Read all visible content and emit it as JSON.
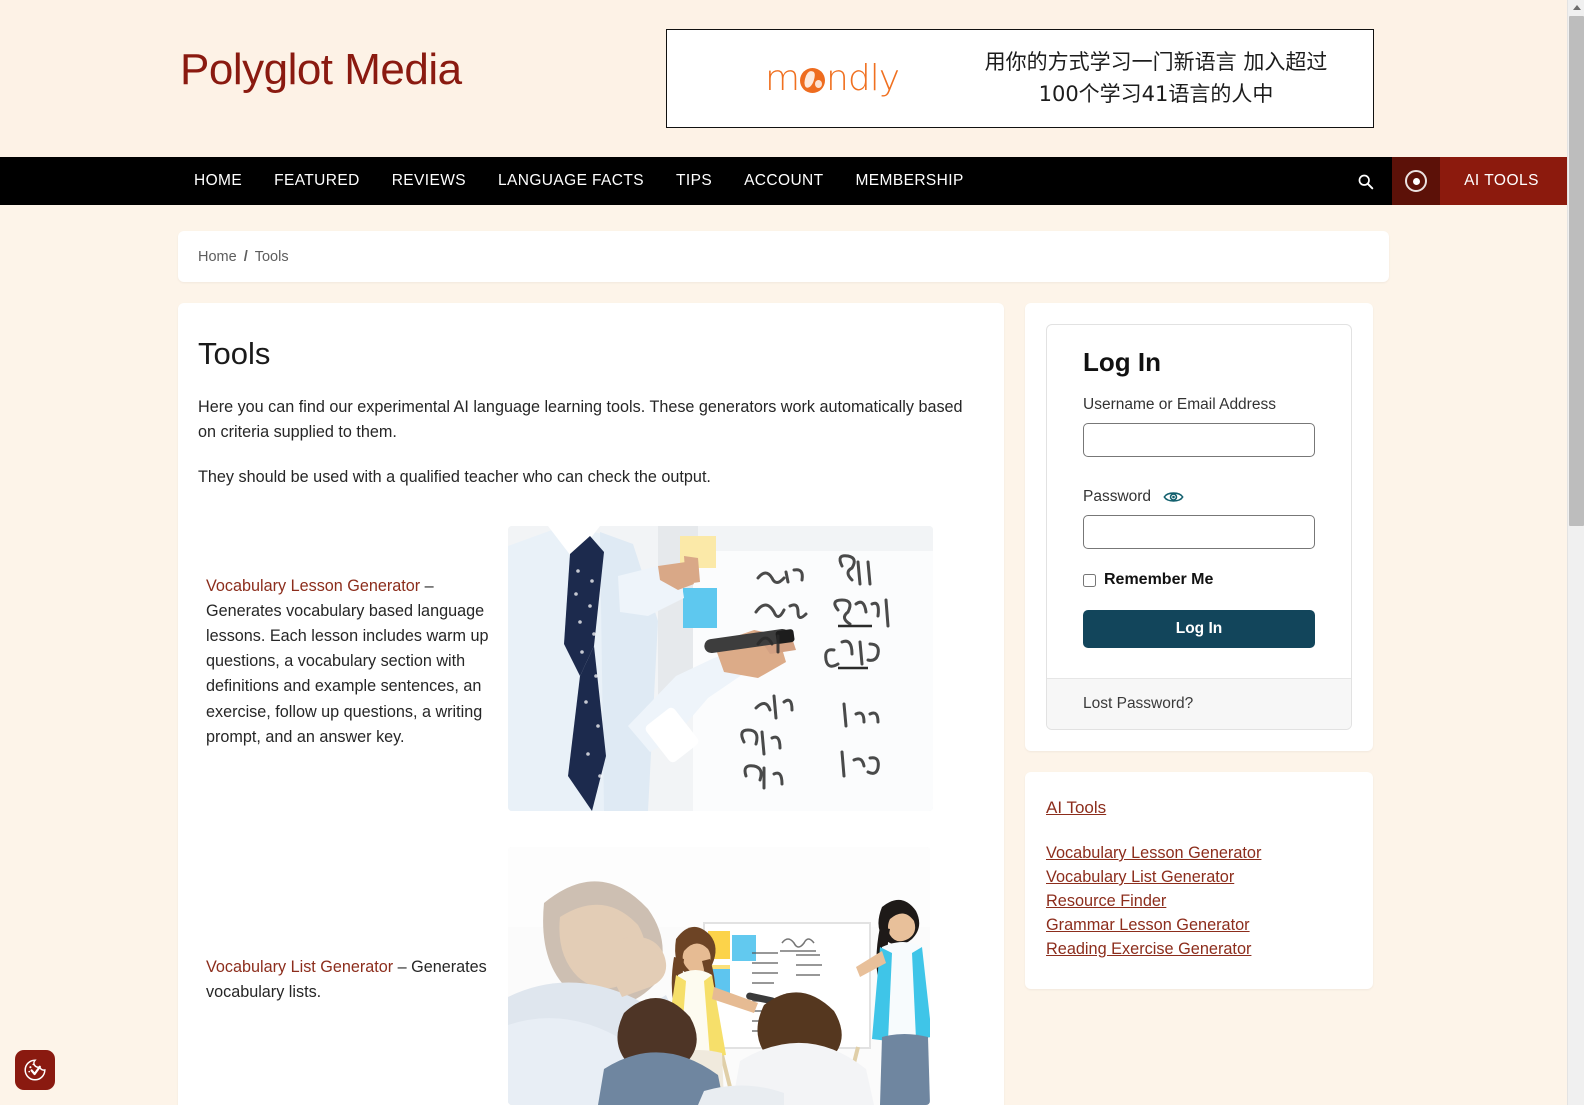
{
  "site": {
    "logo_text": "Polyglot Media"
  },
  "ad": {
    "brand": "mondly",
    "brand_pre": "m",
    "brand_post": "ndly",
    "copy_line1": "用你的方式学习一门新语言 加入超过",
    "copy_line2": "100个学习41语言的人中"
  },
  "nav": {
    "items": [
      {
        "label": "HOME"
      },
      {
        "label": "FEATURED"
      },
      {
        "label": "REVIEWS"
      },
      {
        "label": "LANGUAGE FACTS"
      },
      {
        "label": "TIPS"
      },
      {
        "label": "ACCOUNT"
      },
      {
        "label": "MEMBERSHIP"
      }
    ],
    "search_icon": "search-icon",
    "ai_icon": "record-dot-icon",
    "ai_button_label": "AI TOOLS"
  },
  "breadcrumb": {
    "home": "Home",
    "separator": "/",
    "current": "Tools"
  },
  "main": {
    "title": "Tools",
    "paragraph1": "Here you can find our experimental AI language learning tools. These generators work automatically based on criteria supplied to them.",
    "paragraph2": "They should be used with a qualified teacher who can check the output.",
    "tools": [
      {
        "link_label": "Vocabulary Lesson Generator",
        "description": " – Generates vocabulary based language lessons. Each lesson includes warm up questions, a vocabulary section with definitions and example sentences, an exercise, follow up questions, a writing prompt, and an answer key.",
        "image_name": "teacher-writing-on-whiteboard-photo"
      },
      {
        "link_label": "Vocabulary List Generator",
        "description": " – Generates vocabulary lists.",
        "image_name": "classroom-lesson-photo"
      }
    ]
  },
  "login": {
    "title": "Log In",
    "username_label": "Username or Email Address",
    "username_value": "",
    "username_placeholder": "",
    "password_label": "Password",
    "password_value": "",
    "password_placeholder": "",
    "show_password_icon": "eye-icon",
    "remember_label": "Remember Me",
    "submit_label": "Log In",
    "lost_password_label": "Lost Password?"
  },
  "widget": {
    "title": "AI Tools",
    "links": [
      {
        "label": "Vocabulary Lesson Generator"
      },
      {
        "label": "Vocabulary List Generator"
      },
      {
        "label": "Resource Finder"
      },
      {
        "label": "Grammar Lesson Generator"
      },
      {
        "label": "Reading Exercise Generator"
      }
    ]
  },
  "cookie_badge": {
    "icon": "cookie-consent-icon"
  },
  "colors": {
    "page_background": "#fdf4e9",
    "brand_red": "#8a1a10",
    "link_red": "#8c2d1c",
    "nav_background": "#000000",
    "ai_button": "#8c1a0d",
    "ai_icon_block": "#5c1108",
    "login_button": "#12455b",
    "ad_orange": "#ee6c1f"
  }
}
